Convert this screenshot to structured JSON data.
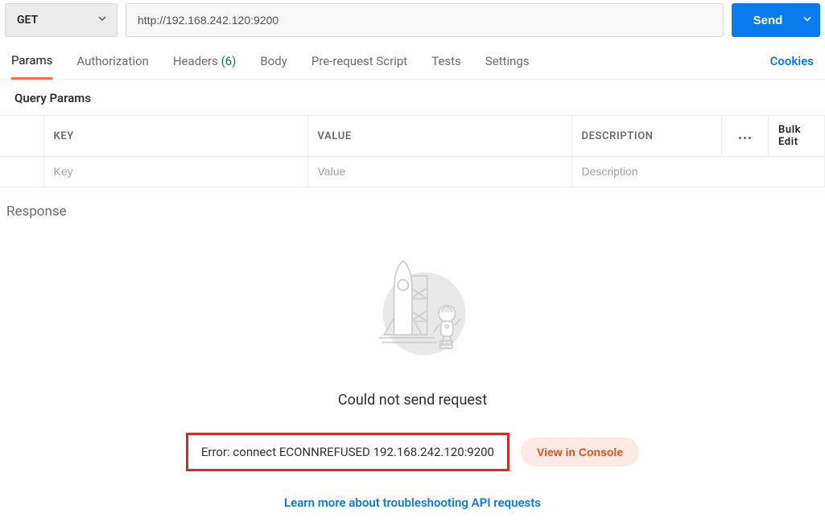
{
  "request": {
    "method": "GET",
    "url": "http://192.168.242.120:9200",
    "send_label": "Send"
  },
  "tabs": {
    "params": "Params",
    "authorization": "Authorization",
    "headers": "Headers",
    "headers_count": "(6)",
    "body": "Body",
    "prerequest": "Pre-request Script",
    "tests": "Tests",
    "settings": "Settings",
    "cookies": "Cookies"
  },
  "section": {
    "query_params": "Query Params"
  },
  "table": {
    "headers": {
      "key": "KEY",
      "value": "VALUE",
      "description": "DESCRIPTION",
      "bulk": "Bulk Edit"
    },
    "placeholders": {
      "key": "Key",
      "value": "Value",
      "description": "Description"
    }
  },
  "response": {
    "label": "Response",
    "heading": "Could not send request",
    "error_text": "Error: connect ECONNREFUSED 192.168.242.120:9200",
    "view_console": "View in Console",
    "learn_more": "Learn more about troubleshooting API requests"
  }
}
